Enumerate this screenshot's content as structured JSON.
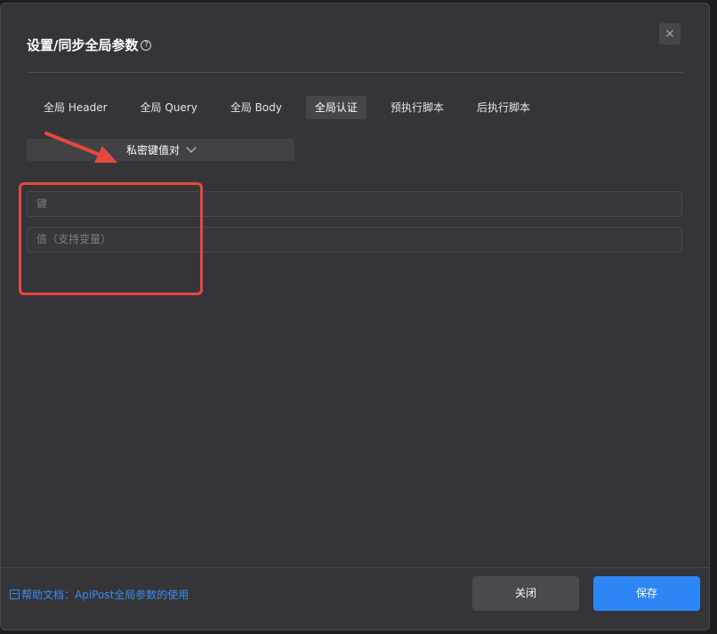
{
  "dialog": {
    "title": "设置/同步全局参数",
    "help_icon": "?",
    "close_icon": "×"
  },
  "tabs": [
    {
      "label": "全局 Header",
      "active": false
    },
    {
      "label": "全局 Query",
      "active": false
    },
    {
      "label": "全局 Body",
      "active": false
    },
    {
      "label": "全局认证",
      "active": true
    },
    {
      "label": "预执行脚本",
      "active": false
    },
    {
      "label": "后执行脚本",
      "active": false
    }
  ],
  "auth": {
    "type_label": "私密键值对",
    "key_placeholder": "键",
    "value_placeholder": "值（支持变量）"
  },
  "footer": {
    "help_text": "帮助文档：ApiPost全局参数的使用",
    "close_label": "关闭",
    "save_label": "保存"
  },
  "colors": {
    "accent": "#2e86f4",
    "annotation": "#e5483f"
  }
}
